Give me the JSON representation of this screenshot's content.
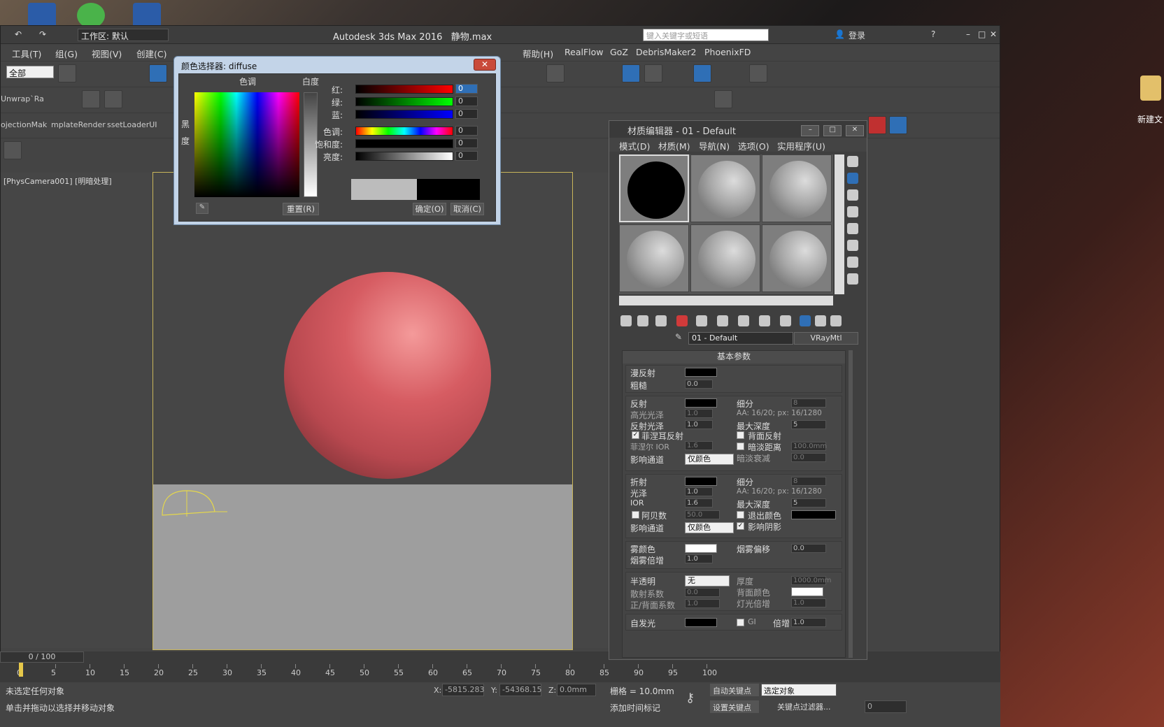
{
  "app": {
    "title": "Autodesk 3ds Max 2016",
    "file": "静物.max",
    "workspace_label": "工作区: 默认",
    "search_placeholder": "键入关键字或短语",
    "login": "登录"
  },
  "menu": [
    "工具(T)",
    "组(G)",
    "视图(V)",
    "创建(C)",
    "帮助(H)",
    "RealFlow",
    "GoZ",
    "DebrisMaker2",
    "PhoenixFD"
  ],
  "toolbar": {
    "selection_filter": "全部",
    "plugin_tabs": [
      "Unwrap`Ra",
      "ojectionMak",
      "mplateRender",
      "ssetLoaderUI"
    ]
  },
  "viewport": {
    "label": "[PhysCamera001] [明暗处理]"
  },
  "color_picker": {
    "title": "颜色选择器: diffuse",
    "hue_label": "色调",
    "whiteness_label": "白度",
    "blackness_label": "黑度",
    "channels": [
      {
        "label": "红:",
        "value": "0"
      },
      {
        "label": "绿:",
        "value": "0"
      },
      {
        "label": "蓝:",
        "value": "0"
      },
      {
        "label": "色调:",
        "value": "0"
      },
      {
        "label": "饱和度:",
        "value": "0"
      },
      {
        "label": "亮度:",
        "value": "0"
      }
    ],
    "reset": "重置(R)",
    "ok": "确定(O)",
    "cancel": "取消(C)",
    "old_color": "#bcbcbc",
    "new_color": "#000000"
  },
  "material_editor": {
    "title": "材质编辑器 - 01 - Default",
    "menu": [
      "模式(D)",
      "材质(M)",
      "导航(N)",
      "选项(O)",
      "实用程序(U)"
    ],
    "material_name": "01 - Default",
    "material_type": "VRayMtl",
    "rollout_title": "基本参数",
    "diffuse": {
      "label": "漫反射",
      "rough_label": "粗糙",
      "rough": "0.0"
    },
    "reflect": {
      "label": "反射",
      "hilight_label": "高光光泽",
      "hilight": "1.0",
      "gloss_label": "反射光泽",
      "gloss": "1.0",
      "fresnel_label": "菲涅耳反射",
      "fresnel_ior_label": "菲涅尔 IOR",
      "fresnel_ior": "1.6",
      "channel_label": "影响通道",
      "channel": "仅颜色",
      "subdivs_label": "细分",
      "subdivs": "8",
      "aa_text": "AA: 16/20; px: 16/1280",
      "maxdepth_label": "最大深度",
      "maxdepth": "5",
      "backside_label": "背面反射",
      "dim_label": "暗淡距离",
      "dim_dist": "100.0mm",
      "dim_falloff_label": "暗淡衰减",
      "dim_falloff": "0.0"
    },
    "refract": {
      "label": "折射",
      "gloss_label": "光泽",
      "gloss": "1.0",
      "ior_label": "IOR",
      "ior": "1.6",
      "abbe_label": "阿贝数",
      "abbe": "50.0",
      "channel_label": "影响通道",
      "channel": "仅颜色",
      "subdivs_label": "细分",
      "subdivs": "8",
      "aa_text": "AA: 16/20; px: 16/1280",
      "maxdepth_label": "最大深度",
      "maxdepth": "5",
      "exit_label": "退出颜色",
      "shadow_label": "影响阴影"
    },
    "fog": {
      "color_label": "雾颜色",
      "mult_label": "烟雾倍增",
      "mult": "1.0",
      "bias_label": "烟雾偏移",
      "bias": "0.0"
    },
    "translucency": {
      "label": "半透明",
      "value": "无",
      "scatter_label": "散射系数",
      "scatter": "0.0",
      "fwdbck_label": "正/背面系数",
      "fwdbck": "1.0",
      "thick_label": "厚度",
      "thick": "1000.0mm",
      "back_label": "背面颜色",
      "light_label": "灯光倍增",
      "light": "1.0"
    },
    "selfillum": {
      "label": "自发光",
      "gi_label": "GI",
      "mult_label": "倍增",
      "mult": "1.0"
    }
  },
  "timeline": {
    "frame": "0 / 100",
    "ticks": [
      "0",
      "5",
      "10",
      "15",
      "20",
      "25",
      "30",
      "35",
      "40",
      "45",
      "50",
      "55",
      "60",
      "65",
      "70",
      "75",
      "80",
      "85",
      "90",
      "95",
      "100"
    ]
  },
  "status": {
    "line1": "未选定任何对象",
    "line2": "单击并拖动以选择并移动对象",
    "x": "-5815.283",
    "y": "-54368.15",
    "z": "0.0mm",
    "grid": "栅格 = 10.0mm",
    "autokey": "自动关键点",
    "setkey": "设置关键点",
    "selected": "选定对象",
    "keyfilter": "关键点过滤器...",
    "addtime": "添加时间标记",
    "frame_field": "0"
  },
  "desktop": {
    "new_folder": "新建文"
  }
}
